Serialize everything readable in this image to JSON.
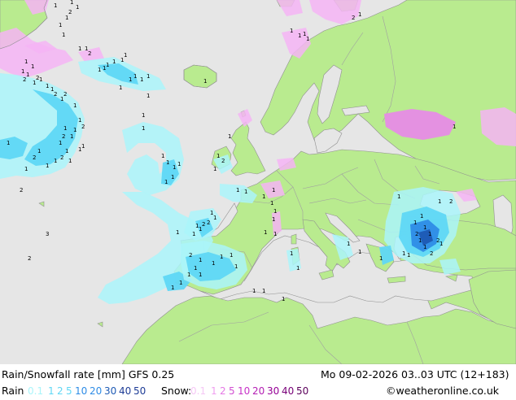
{
  "map": {
    "colors": {
      "sea": "#e6e6e6",
      "land": "#b9eb8f",
      "border": "#a0a0a0",
      "coast": "#909090",
      "rain_light": "#aaf5fa",
      "rain_mid": "#5fd7f5",
      "rain_heavy": "#2e8ce6",
      "rain_dark": "#1e5ab4",
      "snow_light": "#f5b4f5",
      "snow_mid": "#e68ce6",
      "label": "#000000"
    },
    "point_labels": [
      "1",
      "1",
      "1",
      "2",
      "1",
      "1",
      "1",
      "1",
      "1",
      "2",
      "1",
      "1",
      "1",
      "1",
      "2",
      "2",
      "1",
      "1",
      "1",
      "1",
      "2",
      "1",
      "2",
      "1",
      "1",
      "2",
      "1",
      "1",
      "1",
      "2",
      "1",
      "1",
      "2",
      "1",
      "1",
      "1",
      "1",
      "1",
      "1",
      "2",
      "1",
      "1",
      "1",
      "1",
      "1",
      "1",
      "1",
      "1",
      "1",
      "1",
      "1",
      "1",
      "1",
      "1",
      "1",
      "1",
      "1",
      "1",
      "1",
      "1",
      "1",
      "2",
      "1",
      "1",
      "1",
      "1",
      "1",
      "1",
      "1",
      "1",
      "1",
      "1",
      "1",
      "1",
      "2",
      "1",
      "1",
      "1",
      "2",
      "1",
      "2",
      "1",
      "1",
      "1",
      "1",
      "1",
      "1",
      "1",
      "1",
      "1",
      "1",
      "1",
      "1",
      "1",
      "1",
      "1",
      "1",
      "2",
      "1",
      "1",
      "1",
      "2",
      "1",
      "1",
      "2",
      "1",
      "2",
      "1",
      "1",
      "1",
      "1",
      "1",
      "1",
      "1",
      "1",
      "1",
      "2",
      "1",
      "1",
      "1",
      "1",
      "1",
      "2",
      "3",
      "2",
      "1",
      "1",
      "1",
      "1",
      "2",
      "1",
      "1",
      "1",
      "2",
      "1",
      "2",
      "1",
      "1",
      "2",
      "1",
      "1",
      "1",
      "1",
      "1",
      "1",
      "2",
      "1",
      "1",
      "1",
      "1",
      "1",
      "1",
      "1",
      "1",
      "1",
      "1",
      "1",
      "1",
      "1"
    ]
  },
  "footer": {
    "title": "Rain/Snowfall rate [mm] GFS 0.25",
    "datetime": "Mo 09-02-2026 03..03 UTC (12+183)",
    "rain_label": "Rain",
    "snow_label": "Snow:",
    "credit": "©weatheronline.co.uk",
    "rain_scale": [
      {
        "v": "0.1",
        "c": "#aaf5fa"
      },
      {
        "v": "1",
        "c": "#5fd7f5"
      },
      {
        "v": "2",
        "c": "#5fd7f5"
      },
      {
        "v": "5",
        "c": "#5fd7f5"
      },
      {
        "v": "10",
        "c": "#2e8ce6"
      },
      {
        "v": "20",
        "c": "#2e8ce6"
      },
      {
        "v": "30",
        "c": "#1e5ab4"
      },
      {
        "v": "40",
        "c": "#1e3c96"
      },
      {
        "v": "50",
        "c": "#1e3c96"
      }
    ],
    "snow_scale": [
      {
        "v": "0.1",
        "c": "#f5c8f5"
      },
      {
        "v": "1",
        "c": "#f0a0f0"
      },
      {
        "v": "2",
        "c": "#e678e6"
      },
      {
        "v": "5",
        "c": "#d250d2"
      },
      {
        "v": "10",
        "c": "#c832c8"
      },
      {
        "v": "20",
        "c": "#b41eb4"
      },
      {
        "v": "30",
        "c": "#960096"
      },
      {
        "v": "40",
        "c": "#780078"
      },
      {
        "v": "50",
        "c": "#5a005a"
      }
    ]
  }
}
